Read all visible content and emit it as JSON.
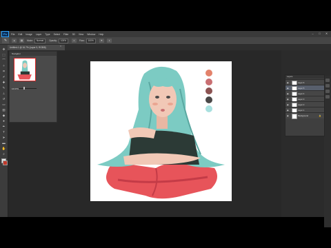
{
  "app": {
    "logo": "Ps"
  },
  "menu": [
    "File",
    "Edit",
    "Image",
    "Layer",
    "Type",
    "Select",
    "Filter",
    "3D",
    "View",
    "Window",
    "Help"
  ],
  "window_controls": [
    "–",
    "□",
    "✕"
  ],
  "options_bar": {
    "tool_icon": "brush-icon",
    "mode_label": "Mode:",
    "mode_value": "Normal",
    "opacity_label": "Opacity:",
    "opacity_value": "100%",
    "flow_label": "Flow:",
    "flow_value": "100%"
  },
  "document_tab": {
    "title": "Untitled-1 @ 16.7% (Layer 5, RGB/8)",
    "close": "×"
  },
  "navigator": {
    "title": "Navigator",
    "zoom": "16.67%"
  },
  "palette_colors": [
    "#e3826b",
    "#c96f72",
    "#8c5352",
    "#4a4848",
    "#a8e0df"
  ],
  "layers_panel": {
    "title": "Layers",
    "layers": [
      {
        "name": "Layer 6"
      },
      {
        "name": "Layer 5",
        "selected": true
      },
      {
        "name": "Layer 4"
      },
      {
        "name": "Layer 3"
      },
      {
        "name": "Layer 2"
      },
      {
        "name": "Layer 1"
      },
      {
        "name": "Background",
        "locked": true
      }
    ]
  },
  "colors": {
    "app_bg": "#2b2b2b",
    "panel_bg": "#3f3f3f",
    "selected_layer": "#585f6c",
    "hair": "#7ccbc3",
    "pillow": "#e7545a",
    "skin": "#f1c8b6",
    "foreground_swatch": "#e6e6e6",
    "background_swatch": "#c0392b"
  }
}
